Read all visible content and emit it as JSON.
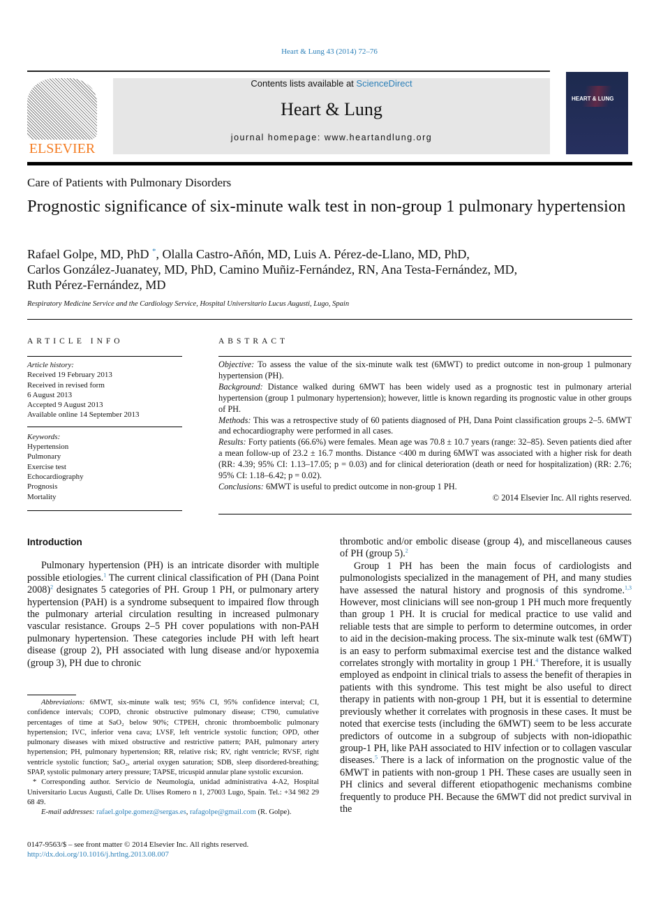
{
  "header": {
    "citation": "Heart & Lung 43 (2014) 72–76",
    "contents_prefix": "Contents lists available at ",
    "sciencedirect": "ScienceDirect",
    "journal_name": "Heart & Lung",
    "homepage": "journal homepage: www.heartandlung.org",
    "publisher_logo": "ELSEVIER",
    "cover_title": "HEART & LUNG"
  },
  "article": {
    "section": "Care of Patients with Pulmonary Disorders",
    "title": "Prognostic significance of six-minute walk test in non-group 1 pulmonary hypertension",
    "authors_line1": "Rafael Golpe, MD, PhD",
    "author_mark": "*",
    "authors_line1b": ", Olalla Castro-Añón, MD, Luis A. Pérez-de-Llano, MD, PhD,",
    "authors_line2": "Carlos González-Juanatey, MD, PhD, Camino Muñiz-Fernández, RN, Ana Testa-Fernández, MD,",
    "authors_line3": "Ruth Pérez-Fernández, MD",
    "affiliation": "Respiratory Medicine Service and the Cardiology Service, Hospital Universitario Lucus Augusti, Lugo, Spain"
  },
  "info": {
    "heading": "ARTICLE INFO",
    "history_label": "Article history:",
    "history": [
      "Received 19 February 2013",
      "Received in revised form",
      "6 August 2013",
      "Accepted 9 August 2013",
      "Available online 14 September 2013"
    ],
    "keywords_label": "Keywords:",
    "keywords": [
      "Hypertension",
      "Pulmonary",
      "Exercise test",
      "Echocardiography",
      "Prognosis",
      "Mortality"
    ]
  },
  "abstract": {
    "heading": "ABSTRACT",
    "objective_label": "Objective:",
    "objective": " To assess the value of the six-minute walk test (6MWT) to predict outcome in non-group 1 pulmonary hypertension (PH).",
    "background_label": "Background:",
    "background": " Distance walked during 6MWT has been widely used as a prognostic test in pulmonary arterial hypertension (group 1 pulmonary hypertension); however, little is known regarding its prognostic value in other groups of PH.",
    "methods_label": "Methods:",
    "methods": " This was a retrospective study of 60 patients diagnosed of PH, Dana Point classification groups 2–5. 6MWT and echocardiography were performed in all cases.",
    "results_label": "Results:",
    "results": " Forty patients (66.6%) were females. Mean age was 70.8 ± 10.7 years (range: 32–85). Seven patients died after a mean follow-up of 23.2 ± 16.7 months. Distance <400 m during 6MWT was associated with a higher risk for death (RR: 4.39; 95% CI: 1.13–17.05; p = 0.03) and for clinical deterioration (death or need for hospitalization) (RR: 2.76; 95% CI: 1.18–6.42; p = 0.02).",
    "conclusions_label": "Conclusions:",
    "conclusions": " 6MWT is useful to predict outcome in non-group 1 PH.",
    "copyright": "© 2014 Elsevier Inc. All rights reserved."
  },
  "body": {
    "intro_heading": "Introduction",
    "p1a": "Pulmonary hypertension (PH) is an intricate disorder with multiple possible etiologies.",
    "p1s1": "1",
    "p1b": " The current clinical classification of PH (Dana Point 2008)",
    "p1s2": "2",
    "p1c": " designates 5 categories of PH. Group 1 PH, or pulmonary artery hypertension (PAH) is a syndrome subsequent to impaired flow through the pulmonary arterial circulation resulting in increased pulmonary vascular resistance. Groups 2–5 PH cover populations with non-PAH pulmonary hypertension. These categories include PH with left heart disease (group 2), PH associated with lung disease and/or hypoxemia (group 3), PH due to chronic",
    "r1a": "thrombotic and/or embolic disease (group 4), and miscellaneous causes of PH (group 5).",
    "r1s": "2",
    "r2a": "Group 1 PH has been the main focus of cardiologists and pulmonologists specialized in the management of PH, and many studies have assessed the natural history and prognosis of this syndrome.",
    "r2s1": "1,3",
    "r2b": " However, most clinicians will see non-group 1 PH much more frequently than group 1 PH. It is crucial for medical practice to use valid and reliable tests that are simple to perform to determine outcomes, in order to aid in the decision-making process. The six-minute walk test (6MWT) is an easy to perform submaximal exercise test and the distance walked correlates strongly with mortality in group 1 PH.",
    "r2s2": "4",
    "r2c": " Therefore, it is usually employed as endpoint in clinical trials to assess the benefit of therapies in patients with this syndrome. This test might be also useful to direct therapy in patients with non-group 1 PH, but it is essential to determine previously whether it correlates with prognosis in these cases. It must be noted that exercise tests (including the 6MWT) seem to be less accurate predictors of outcome in a subgroup of subjects with non-idiopathic group-1 PH, like PAH associated to HIV infection or to collagen vascular diseases.",
    "r2s3": "5",
    "r2d": " There is a lack of information on the prognostic value of the 6MWT in patients with non-group 1 PH. These cases are usually seen in PH clinics and several different etiopathogenic mechanisms combine frequently to produce PH. Because the 6MWT did not predict survival in the"
  },
  "footnotes": {
    "abbr_label": "Abbreviations:",
    "abbr": " 6MWT, six-minute walk test; 95% CI, 95% confidence interval; CI, confidence intervals; COPD, chronic obstructive pulmonary disease; CT90, cumulative percentages of time at SaO₂ below 90%; CTPEH, chronic thromboembolic pulmonary hypertension; IVC, inferior vena cava; LVSF, left ventricle systolic function; OPD, other pulmonary diseases with mixed obstructive and restrictive pattern; PAH, pulmonary artery hypertension; PH, pulmonary hypertension; RR, relative risk; RV, right ventricle; RVSF, right ventricle systolic function; SaO₂, arterial oxygen saturation; SDB, sleep disordered-breathing; SPAP, systolic pulmonary artery pressure; TAPSE, tricuspid annular plane systolic excursion.",
    "corresponding": "* Corresponding author. Servicio de Neumología, unidad administrativa 4-A2, Hospital Universitario Lucus Augusti, Calle Dr. Ulises Romero n 1, 27003 Lugo, Spain. Tel.: +34 982 29 68 49.",
    "email_label": "E-mail addresses:",
    "email1": "rafael.golpe.gomez@sergas.es",
    "sep": ", ",
    "email2": "rafagolpe@gmail.com",
    "email_suffix": " (R. Golpe)."
  },
  "bottom": {
    "issn": "0147-9563/$ – see front matter © 2014 Elsevier Inc. All rights reserved.",
    "doi": "http://dx.doi.org/10.1016/j.hrtlng.2013.08.007"
  },
  "colors": {
    "link": "#2a7fb8",
    "elsevier_orange": "#f47b20",
    "banner_gray": "#e6e6e6"
  }
}
